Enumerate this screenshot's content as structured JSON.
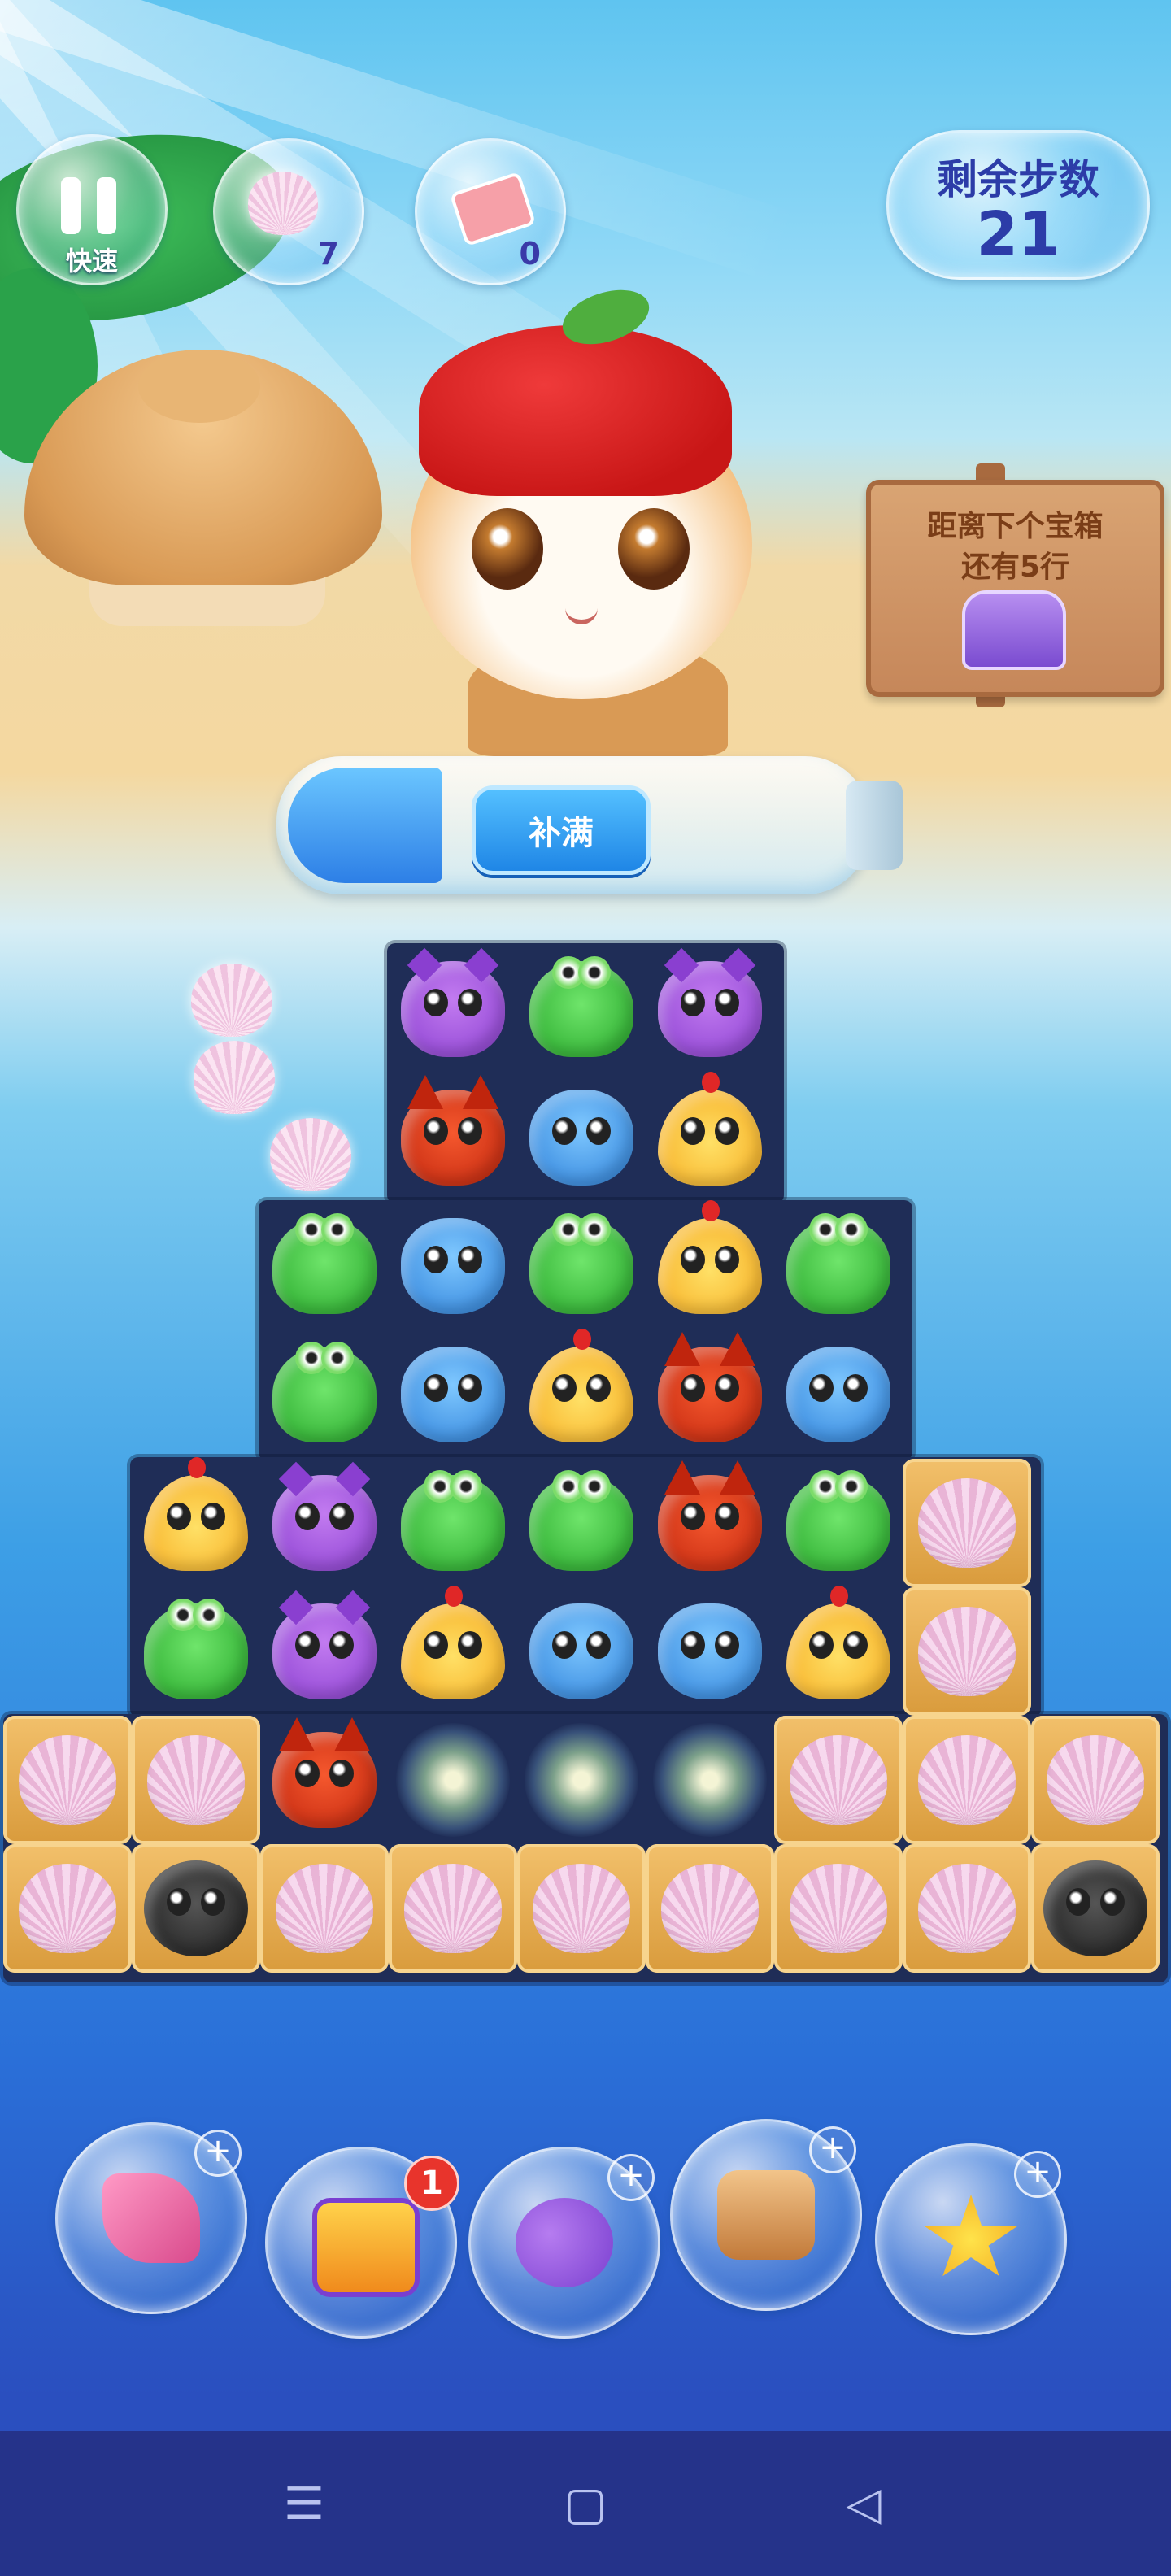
{
  "hud": {
    "pause_label": "快速",
    "shells_collected": "7",
    "tickets": "0",
    "moves_title": "剩余步数",
    "moves_remaining": "21"
  },
  "chest_sign": {
    "line1": "距离下个宝箱",
    "line2": "还有5行"
  },
  "bottle": {
    "refill_label": "补满"
  },
  "board": {
    "legend": {
      "O": "owl",
      "G": "frog",
      "F": "fox",
      "H": "hippo",
      "C": "chick",
      "S": "shell-tile",
      "B": "black-fluff",
      "X": "sparkle",
      "_": "empty"
    },
    "rows": [
      [
        "_",
        "_",
        "_",
        "O",
        "G",
        "O",
        "_",
        "_",
        "_"
      ],
      [
        "_",
        "_",
        "_",
        "F",
        "H",
        "C",
        "_",
        "_",
        "_"
      ],
      [
        "_",
        "_",
        "G",
        "H",
        "G",
        "C",
        "G",
        "_",
        "_"
      ],
      [
        "_",
        "_",
        "G",
        "H",
        "C",
        "F",
        "H",
        "_",
        "_"
      ],
      [
        "_",
        "C",
        "O",
        "G",
        "G",
        "F",
        "G",
        "S",
        "_"
      ],
      [
        "_",
        "G",
        "O",
        "C",
        "H",
        "H",
        "C",
        "S",
        "_"
      ],
      [
        "S",
        "S",
        "F",
        "X",
        "X",
        "X",
        "S",
        "S",
        "S"
      ],
      [
        "S",
        "B",
        "S",
        "S",
        "S",
        "S",
        "S",
        "S",
        "B"
      ]
    ]
  },
  "boosters": [
    {
      "name": "broom",
      "badge": ""
    },
    {
      "name": "shuffle",
      "badge": "1"
    },
    {
      "name": "swap",
      "badge": ""
    },
    {
      "name": "hammer",
      "badge": ""
    },
    {
      "name": "star-wand",
      "badge": ""
    }
  ],
  "nav": {
    "menu_icon": "☰",
    "home_icon": "▢",
    "back_icon": "◁"
  }
}
